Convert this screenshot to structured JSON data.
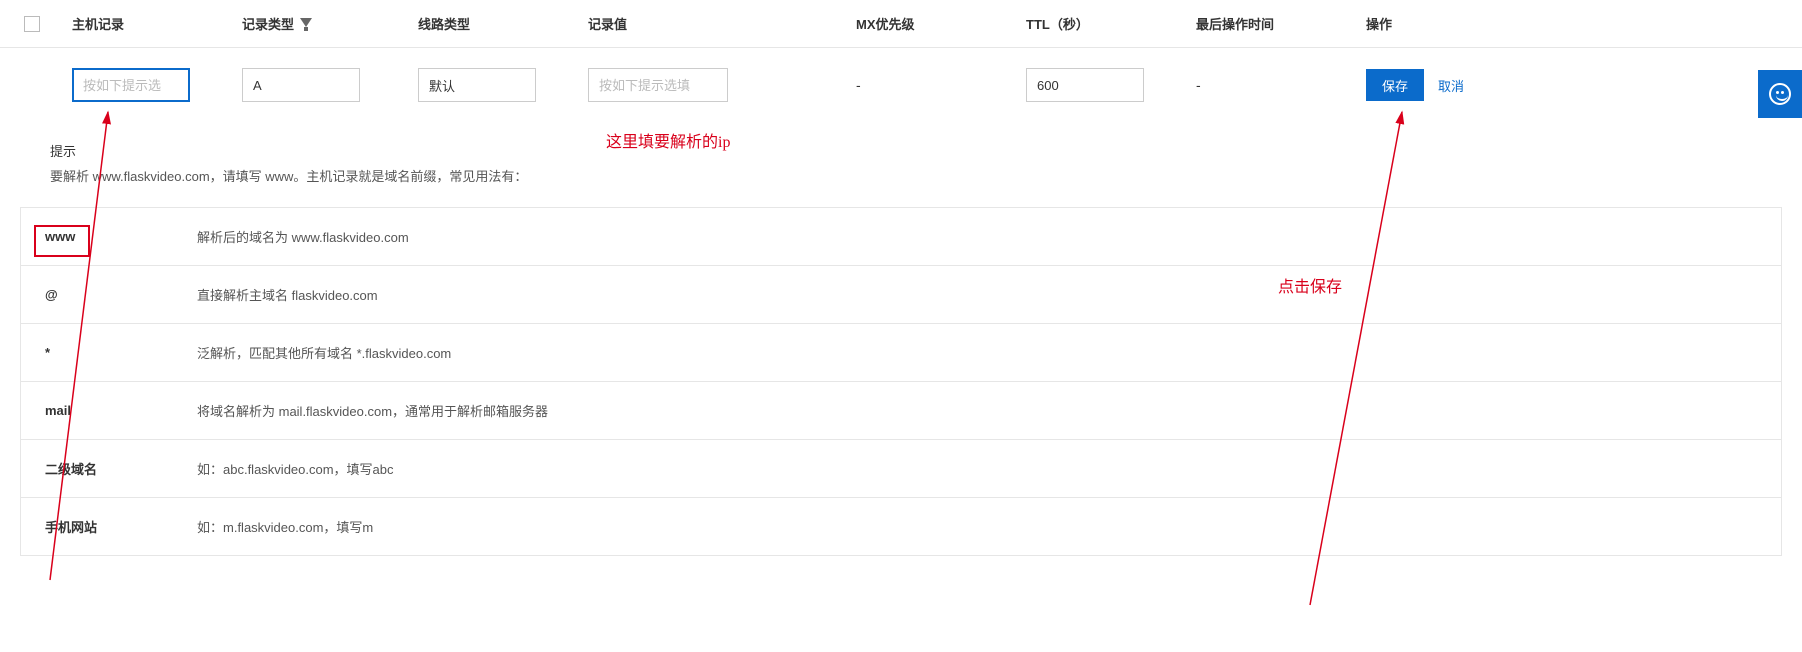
{
  "headers": {
    "host": "主机记录",
    "type": "记录类型",
    "line": "线路类型",
    "value": "记录值",
    "mx": "MX优先级",
    "ttl": "TTL（秒）",
    "lastop": "最后操作时间",
    "ops": "操作"
  },
  "row": {
    "host_placeholder": "按如下提示选",
    "type_value": "A",
    "line_value": "默认",
    "value_placeholder": "按如下提示选填",
    "mx_value": "-",
    "ttl_value": "600",
    "lastop_value": "-",
    "save_label": "保存",
    "cancel_label": "取消"
  },
  "annotations": {
    "value_note": "这里填要解析的ip",
    "save_note": "点击保存"
  },
  "hint": {
    "title": "提示",
    "desc": "要解析 www.flaskvideo.com，请填写 www。主机记录就是域名前缀，常见用法有：",
    "rows": [
      {
        "key": "www",
        "val": "解析后的域名为 www.flaskvideo.com"
      },
      {
        "key": "@",
        "val": "直接解析主域名 flaskvideo.com"
      },
      {
        "key": "*",
        "val": "泛解析，匹配其他所有域名 *.flaskvideo.com"
      },
      {
        "key": "mail",
        "val": "将域名解析为 mail.flaskvideo.com，通常用于解析邮箱服务器"
      },
      {
        "key": "二级域名",
        "val": "如：abc.flaskvideo.com，填写abc"
      },
      {
        "key": "手机网站",
        "val": "如：m.flaskvideo.com，填写m"
      }
    ]
  }
}
